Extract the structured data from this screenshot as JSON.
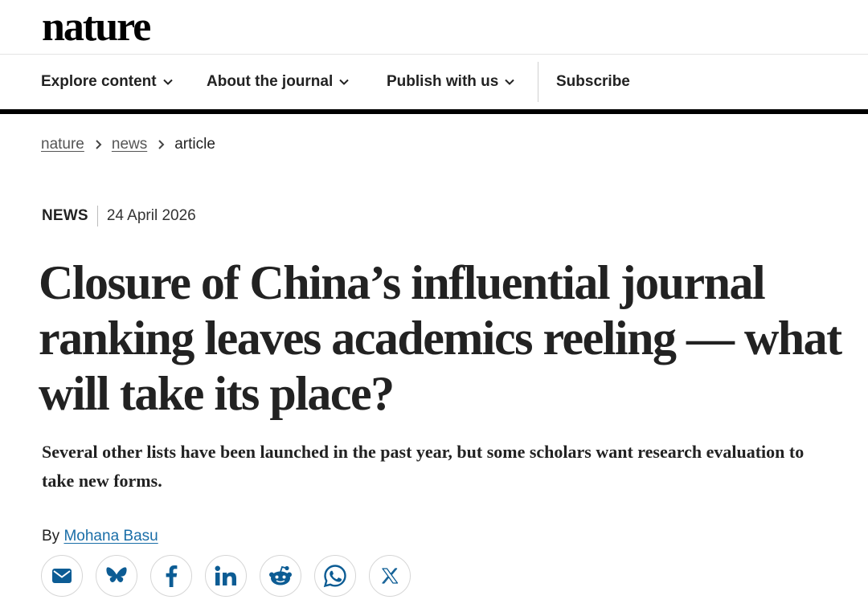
{
  "brand": {
    "logo": "nature"
  },
  "nav": {
    "items": [
      {
        "label": "Explore content",
        "has_dropdown": true
      },
      {
        "label": "About the journal",
        "has_dropdown": true
      },
      {
        "label": "Publish with us",
        "has_dropdown": true
      }
    ],
    "subscribe": "Subscribe"
  },
  "breadcrumb": {
    "items": [
      "nature",
      "news"
    ],
    "current": "article"
  },
  "article": {
    "type": "NEWS",
    "date": "24 April 2026",
    "title": "Closure of China’s influential journal ranking leaves academics reeling — what will take its place?",
    "standfirst": "Several other lists have been launched in the past year, but some scholars want research evaluation to take new forms.",
    "byline_prefix": "By",
    "author": "Mohana Basu"
  },
  "share": {
    "buttons": [
      "email-icon",
      "bluesky-icon",
      "facebook-icon",
      "linkedin-icon",
      "reddit-icon",
      "whatsapp-icon",
      "x-icon"
    ]
  },
  "colors": {
    "text": "#222222",
    "link": "#1a6ea8",
    "icon": "#0c5c94",
    "rule": "#000000"
  }
}
